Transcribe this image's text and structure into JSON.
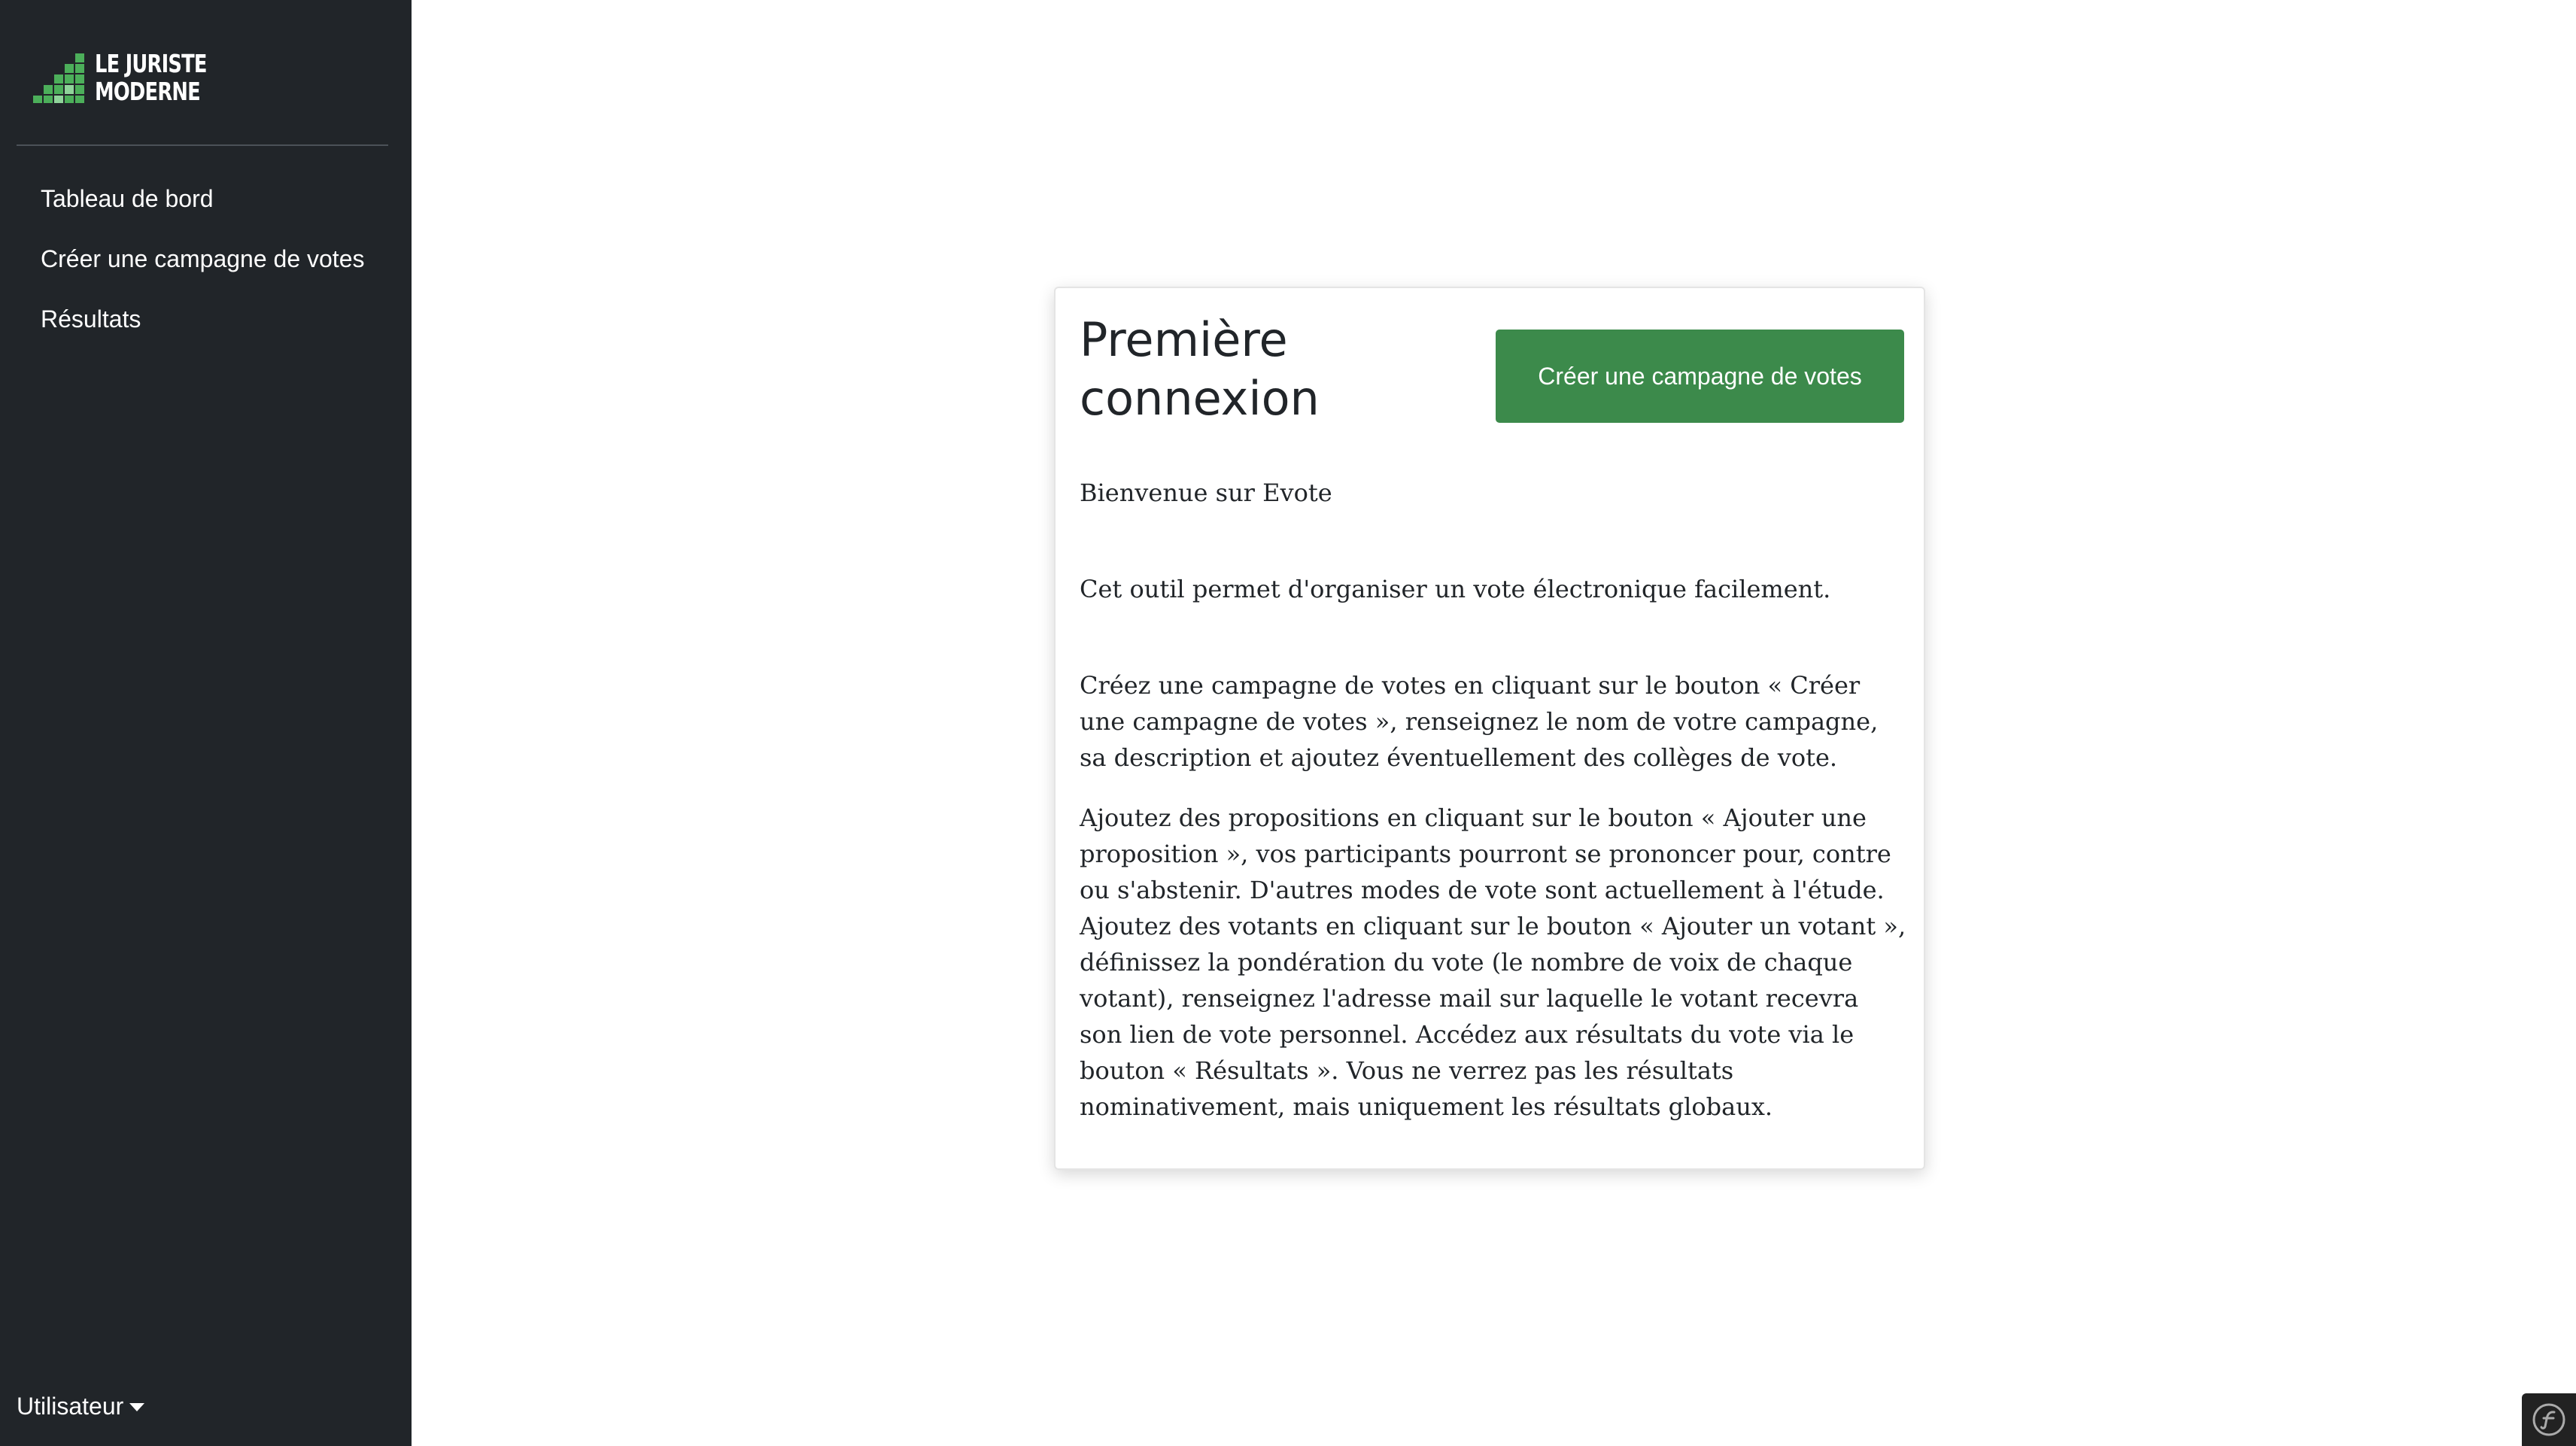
{
  "brand": {
    "logo_line1": "LE JURISTE",
    "logo_line2": "MODERNE",
    "logo_icon": "stepped-squares-logo-icon"
  },
  "sidebar": {
    "items": [
      {
        "label": "Tableau de bord"
      },
      {
        "label": "Créer une campagne de votes"
      },
      {
        "label": "Résultats"
      }
    ],
    "user_menu_label": "Utilisateur"
  },
  "card": {
    "title": "Première connexion",
    "button_label": "Créer une campagne de votes",
    "paragraphs": [
      "Bienvenue sur Evote",
      "Cet outil permet d'organiser un vote électronique facilement.",
      "Créez une campagne de votes en cliquant sur le bouton « Créer une campagne de votes », renseignez le nom de votre campagne, sa description et ajoutez éventuellement des collèges de vote.",
      "Ajoutez des propositions en cliquant sur le bouton « Ajouter une proposition », vos participants pourront se prononcer pour, contre ou s'abstenir. D'autres modes de vote sont actuellement à l'étude. Ajoutez des votants en cliquant sur le bouton « Ajouter un votant », définissez la pondération du vote (le nombre de voix de chaque votant), renseignez l'adresse mail sur laquelle le votant recevra son lien de vote personnel. Accédez aux résultats du vote via le bouton « Résultats ». Vous ne verrez pas les résultats nominativement, mais uniquement les résultats globaux."
    ]
  },
  "colors": {
    "sidebar_bg": "#212529",
    "accent_green": "#3c8a4b",
    "logo_green": "#5cb85c"
  },
  "debug_toolbar_icon": "symfony-icon"
}
